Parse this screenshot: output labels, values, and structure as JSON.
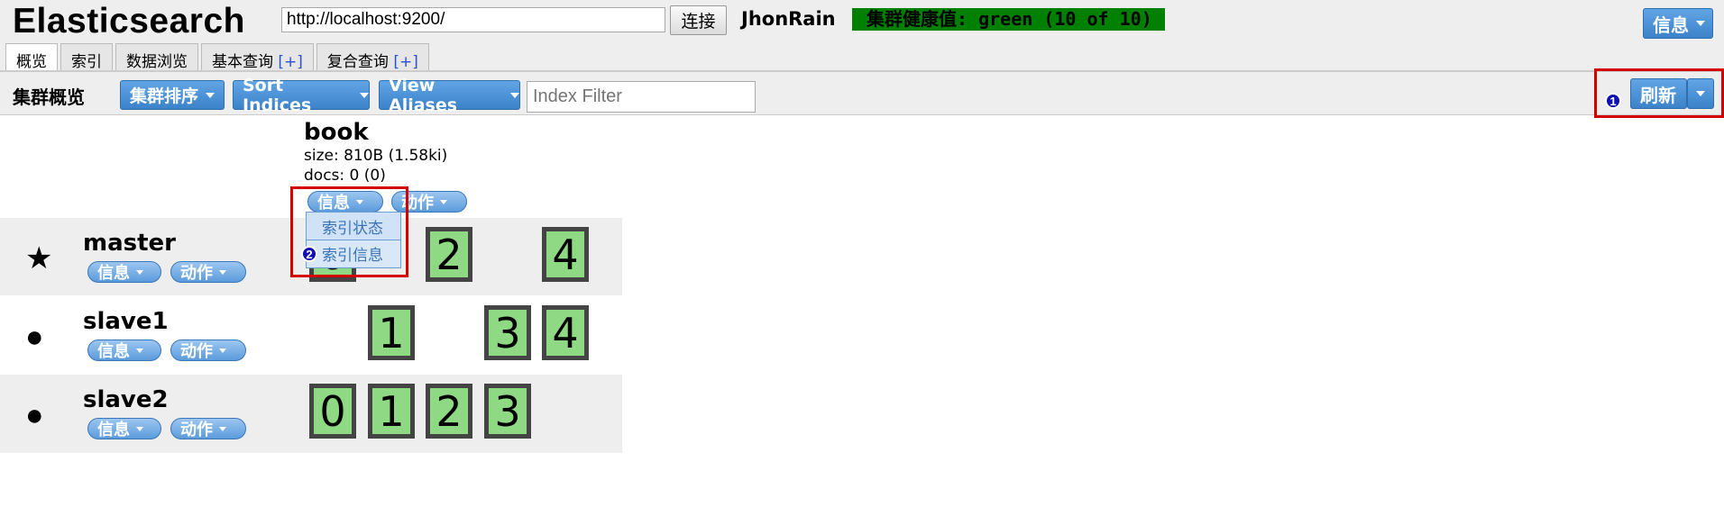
{
  "header": {
    "logo": "Elasticsearch",
    "url_value": "http://localhost:9200/",
    "connect_label": "连接",
    "cluster_name": "JhonRain",
    "health": "集群健康值: green (10 of 10)",
    "info_label": "信息"
  },
  "tabs": [
    {
      "label": "概览"
    },
    {
      "label": "索引"
    },
    {
      "label": "数据浏览"
    },
    {
      "label": "基本查询",
      "plus": "[+]"
    },
    {
      "label": "复合查询",
      "plus": "[+]"
    }
  ],
  "toolbar": {
    "title": "集群概览",
    "sort_cluster": "集群排序",
    "sort_indices": "Sort Indices",
    "view_aliases": "View Aliases",
    "index_filter_placeholder": "Index Filter",
    "refresh_label": "刷新"
  },
  "index": {
    "name": "book",
    "size": "size: 810B (1.58ki)",
    "docs": "docs: 0 (0)",
    "info_label": "信息",
    "action_label": "动作"
  },
  "dropdown": {
    "items": [
      "索引状态",
      "索引信息"
    ]
  },
  "annotations": {
    "badge1": "1",
    "badge2": "2"
  },
  "nodes": [
    {
      "name": "master",
      "icon": "star-icon",
      "glyph": "★",
      "info": "信息",
      "action": "动作",
      "shards": [
        "0",
        "2",
        "4"
      ]
    },
    {
      "name": "slave1",
      "icon": "circle-icon",
      "glyph": "●",
      "info": "信息",
      "action": "动作",
      "shards": [
        "1",
        "3",
        "4"
      ]
    },
    {
      "name": "slave2",
      "icon": "circle-icon",
      "glyph": "●",
      "info": "信息",
      "action": "动作",
      "shards": [
        "0",
        "1",
        "2",
        "3"
      ]
    }
  ],
  "colors": {
    "health": "#008000",
    "shard": "#8fd884",
    "highlight": "#d40000",
    "button": "#3b82c9"
  }
}
